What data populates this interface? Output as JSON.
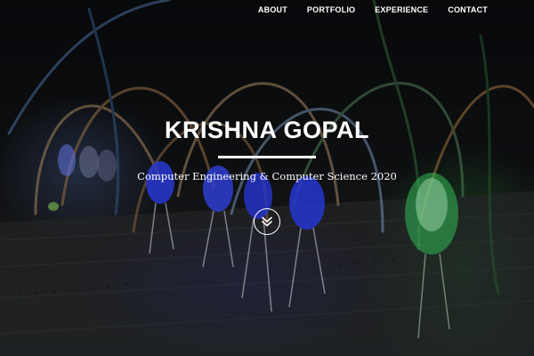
{
  "nav": {
    "items": [
      {
        "label": "ABOUT"
      },
      {
        "label": "PORTFOLIO"
      },
      {
        "label": "EXPERIENCE"
      },
      {
        "label": "CONTACT"
      }
    ]
  },
  "hero": {
    "title": "KRISHNA GOPAL",
    "subtitle": "Computer Engineering & Computer Science 2020",
    "scroll_icon": "double-chevron-down-icon"
  },
  "colors": {
    "text": "#ffffff",
    "led_blue": "#3a4cff",
    "led_green": "#39d65a"
  }
}
